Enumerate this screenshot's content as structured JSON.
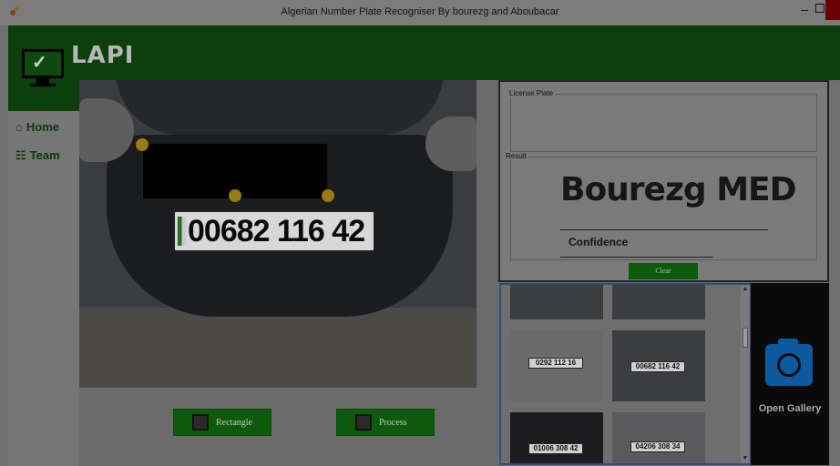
{
  "window": {
    "title": "Algerian Number Plate Recogniser By bourezg and Aboubacar"
  },
  "header": {
    "brand": "LAPI",
    "logo_icon": "monitor-check-icon"
  },
  "sidebar": {
    "items": [
      {
        "label": "Home",
        "icon": "home-icon"
      },
      {
        "label": "Team",
        "icon": "team-icon"
      }
    ]
  },
  "image": {
    "plate_text": "00682 116 42"
  },
  "buttons": {
    "rectangle": "Rectangle",
    "process": "Process",
    "clear": "Clear",
    "open_gallery": "Open Gallery"
  },
  "license_plate": {
    "label": "License Plate",
    "value": ""
  },
  "result": {
    "label": "Result",
    "name": "Bourezg MED",
    "confidence_label": "Confidence"
  },
  "gallery": {
    "thumbnails": [
      "",
      "",
      "0292 112 16",
      "00682 116 42",
      "01006 308 42",
      "04206 308 34"
    ]
  },
  "colors": {
    "accent_green": "#0d5a0d",
    "camera_blue": "#0f5a9e",
    "handle_gold": "#9a7a12"
  }
}
